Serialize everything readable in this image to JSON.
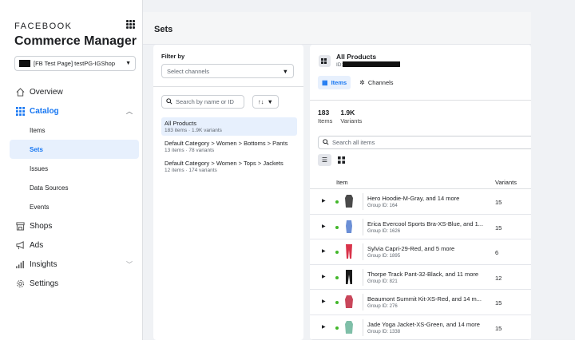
{
  "app": {
    "brand": "FACEBOOK",
    "title": "Commerce Manager"
  },
  "shop_select": {
    "label": "[FB Test Page] testPG-IGShop"
  },
  "sidebar": {
    "items": [
      {
        "label": "Overview",
        "icon": "house-icon"
      },
      {
        "label": "Catalog",
        "icon": "grid-icon"
      },
      {
        "label": "Items"
      },
      {
        "label": "Sets"
      },
      {
        "label": "Issues"
      },
      {
        "label": "Data Sources"
      },
      {
        "label": "Events"
      },
      {
        "label": "Shops",
        "icon": "storefront-icon"
      },
      {
        "label": "Ads",
        "icon": "megaphone-icon"
      },
      {
        "label": "Insights",
        "icon": "bar-chart-icon"
      },
      {
        "label": "Settings",
        "icon": "gear-icon"
      }
    ],
    "selected": "Sets"
  },
  "page": {
    "title": "Sets"
  },
  "filter": {
    "label": "Filter by",
    "channel_placeholder": "Select channels",
    "search_placeholder": "Search by name or ID",
    "sort_label": "↑↓"
  },
  "sets": [
    {
      "name": "All Products",
      "meta": "183 items · 1.9K variants"
    },
    {
      "name": "Default Category > Women > Bottoms > Pants",
      "meta": "13 items · 78 variants"
    },
    {
      "name": "Default Category > Women > Tops > Jackets",
      "meta": "12 items · 174 variants"
    }
  ],
  "detail": {
    "title": "All Products",
    "id_label": "ID:",
    "tabs": [
      {
        "label": "Items"
      },
      {
        "label": "Channels"
      }
    ],
    "stats": [
      {
        "value": "183",
        "label": "Items"
      },
      {
        "value": "1.9K",
        "label": "Variants"
      }
    ],
    "search_placeholder": "Search all items",
    "columns": {
      "item": "Item",
      "variants": "Variants"
    }
  },
  "products": [
    {
      "name": "Hero Hoodie-M-Gray, and 14 more",
      "group": "Group ID: 164",
      "variants": "15",
      "color": "#4a4a4a"
    },
    {
      "name": "Erica Evercool Sports Bra-XS-Blue, and 1...",
      "group": "Group ID: 1626",
      "variants": "15",
      "color": "#6b8fd6"
    },
    {
      "name": "Sylvia Capri-29-Red, and 5 more",
      "group": "Group ID: 1895",
      "variants": "6",
      "color": "#d9334a"
    },
    {
      "name": "Thorpe Track Pant-32-Black, and 11 more",
      "group": "Group ID: 821",
      "variants": "12",
      "color": "#1a1a1a"
    },
    {
      "name": "Beaumont Summit Kit-XS-Red, and 14 m...",
      "group": "Group ID: 276",
      "variants": "15",
      "color": "#c9465a"
    },
    {
      "name": "Jade Yoga Jacket-XS-Green, and 14 more",
      "group": "Group ID: 1338",
      "variants": "15",
      "color": "#7fbfa8"
    }
  ]
}
